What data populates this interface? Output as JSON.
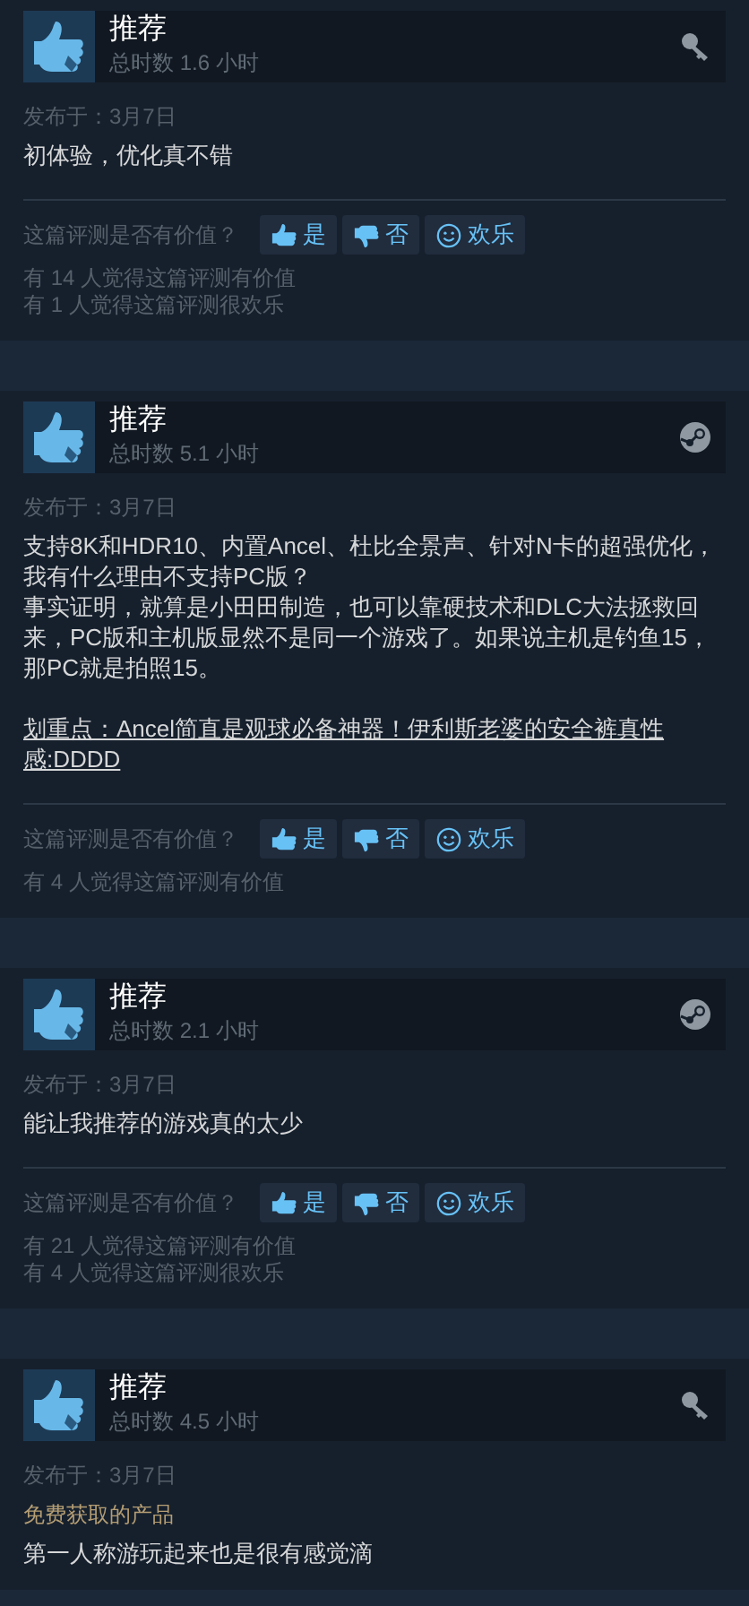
{
  "reviews": [
    {
      "title": "推荐",
      "hours": "总时数 1.6 小时",
      "kind": "key",
      "date": "发布于：3月7日",
      "paragraphs": [
        {
          "text": "初体验，优化真不错",
          "underlined": false
        }
      ],
      "question": "这篇评测是否有价值？",
      "buttons": [
        {
          "kind": "up",
          "label": "是"
        },
        {
          "kind": "down",
          "label": "否"
        },
        {
          "kind": "smile",
          "label": "欢乐"
        }
      ],
      "counts": [
        "有 14 人觉得这篇评测有价值",
        "有 1 人觉得这篇评测很欢乐"
      ]
    },
    {
      "title": "推荐",
      "hours": "总时数 5.1 小时",
      "kind": "steam",
      "date": "发布于：3月7日",
      "paragraphs": [
        {
          "text": "支持8K和HDR10、内置Ancel、杜比全景声、针对N卡的超强优化，我有什么理由不支持PC版？",
          "underlined": false
        },
        {
          "text": "事实证明，就算是小田田制造，也可以靠硬技术和DLC大法拯救回来，PC版和主机版显然不是同一个游戏了。如果说主机是钓鱼15，那PC就是拍照15。",
          "underlined": false
        },
        {
          "text": "划重点：Ancel简直是观球必备神器！伊利斯老婆的安全裤真性感:DDDD",
          "underlined": true
        }
      ],
      "question": "这篇评测是否有价值？",
      "buttons": [
        {
          "kind": "up",
          "label": "是"
        },
        {
          "kind": "down",
          "label": "否"
        },
        {
          "kind": "smile",
          "label": "欢乐"
        }
      ],
      "counts": [
        "有 4 人觉得这篇评测有价值"
      ]
    },
    {
      "title": "推荐",
      "hours": "总时数 2.1 小时",
      "kind": "steam",
      "date": "发布于：3月7日",
      "paragraphs": [
        {
          "text": "能让我推荐的游戏真的太少",
          "underlined": false
        }
      ],
      "question": "这篇评测是否有价值？",
      "buttons": [
        {
          "kind": "up",
          "label": "是"
        },
        {
          "kind": "down",
          "label": "否"
        },
        {
          "kind": "smile",
          "label": "欢乐"
        }
      ],
      "counts": [
        "有 21 人觉得这篇评测有价值",
        "有 4 人觉得这篇评测很欢乐"
      ]
    },
    {
      "title": "推荐",
      "hours": "总时数 4.5 小时",
      "kind": "key",
      "date": "发布于：3月7日",
      "free_label": "免费获取的产品",
      "paragraphs": [
        {
          "text": "第一人称游玩起来也是很有感觉滴",
          "underlined": false
        }
      ]
    }
  ]
}
